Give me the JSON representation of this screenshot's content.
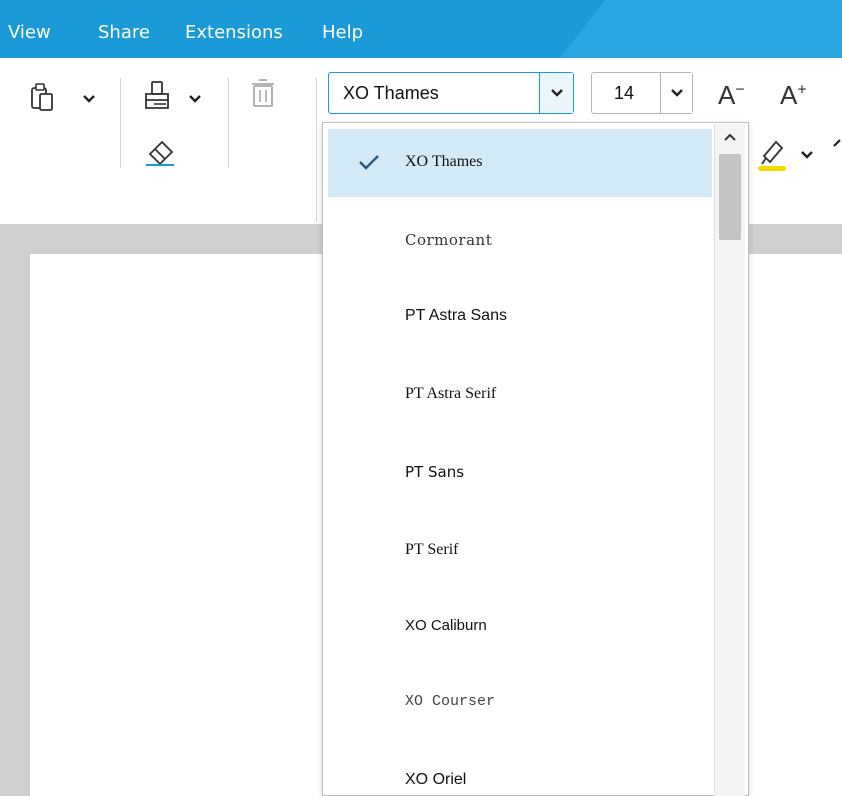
{
  "menubar": {
    "items": [
      "View",
      "Share",
      "Extensions",
      "Help"
    ]
  },
  "toolbar": {
    "icons": [
      "paste-icon",
      "format-painter-icon",
      "delete-icon",
      "eraser-icon",
      "highlight-icon"
    ],
    "font_combo": {
      "value": "XO Thames"
    },
    "size_combo": {
      "value": "14"
    },
    "grow_label": "A",
    "grow_sup_minus": "−",
    "grow_sup_plus": "+"
  },
  "font_dropdown": {
    "selected": "XO Thames",
    "items": [
      "XO Thames",
      "Cormorant",
      "PT Astra Sans",
      "PT Astra Serif",
      "PT Sans",
      "PT Serif",
      "XO Caliburn",
      "XO Courser",
      "XO Oriel"
    ]
  },
  "colors": {
    "accent": "#1a9ad6",
    "selected_row": "#d4eaf7",
    "highlight_yellow": "#f5d800"
  }
}
